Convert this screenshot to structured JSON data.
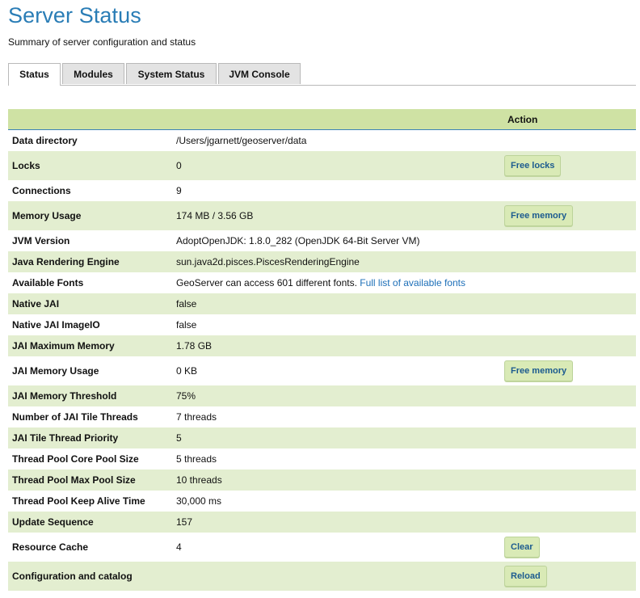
{
  "page": {
    "title": "Server Status",
    "subtitle": "Summary of server configuration and status"
  },
  "tabs": [
    {
      "label": "Status"
    },
    {
      "label": "Modules"
    },
    {
      "label": "System Status"
    },
    {
      "label": "JVM Console"
    }
  ],
  "table": {
    "action_header": "Action",
    "rows": [
      {
        "label": "Data directory",
        "value": "/Users/jgarnett/geoserver/data"
      },
      {
        "label": "Locks",
        "value": "0",
        "action": "Free locks"
      },
      {
        "label": "Connections",
        "value": "9"
      },
      {
        "label": "Memory Usage",
        "value": "174 MB / 3.56 GB",
        "action": "Free memory"
      },
      {
        "label": "JVM Version",
        "value": "AdoptOpenJDK: 1.8.0_282 (OpenJDK 64-Bit Server VM)"
      },
      {
        "label": "Java Rendering Engine",
        "value": "sun.java2d.pisces.PiscesRenderingEngine"
      },
      {
        "label": "Available Fonts",
        "value": "GeoServer can access 601 different fonts.",
        "link": "Full list of available fonts"
      },
      {
        "label": "Native JAI",
        "value": "false"
      },
      {
        "label": "Native JAI ImageIO",
        "value": "false"
      },
      {
        "label": "JAI Maximum Memory",
        "value": "1.78 GB"
      },
      {
        "label": "JAI Memory Usage",
        "value": "0 KB",
        "action": "Free memory"
      },
      {
        "label": "JAI Memory Threshold",
        "value": "75%"
      },
      {
        "label": "Number of JAI Tile Threads",
        "value": "7 threads"
      },
      {
        "label": "JAI Tile Thread Priority",
        "value": "5"
      },
      {
        "label": "Thread Pool Core Pool Size",
        "value": "5 threads"
      },
      {
        "label": "Thread Pool Max Pool Size",
        "value": "10 threads"
      },
      {
        "label": "Thread Pool Keep Alive Time",
        "value": "30,000 ms"
      },
      {
        "label": "Update Sequence",
        "value": "157"
      },
      {
        "label": "Resource Cache",
        "value": "4",
        "action": "Clear"
      },
      {
        "label": "Configuration and catalog",
        "value": "",
        "action": "Reload"
      }
    ]
  },
  "colors": {
    "title": "#2a7db6",
    "row_alt": "#e3eed0",
    "header": "#cfe2a4",
    "button": "#d9eab6",
    "link": "#1d6fb8"
  }
}
